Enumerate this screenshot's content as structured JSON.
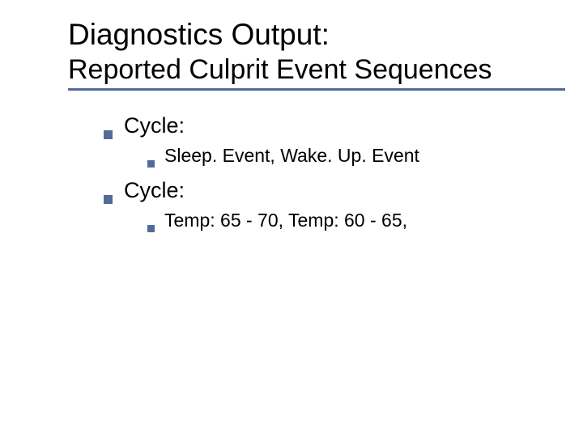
{
  "title": {
    "line1": "Diagnostics Output:",
    "line2": "Reported Culprit Event Sequences"
  },
  "items": [
    {
      "label": "Cycle:",
      "sub": "Sleep. Event, Wake. Up. Event"
    },
    {
      "label": "Cycle:",
      "sub": "Temp: 65 - 70, Temp: 60 - 65,"
    }
  ]
}
